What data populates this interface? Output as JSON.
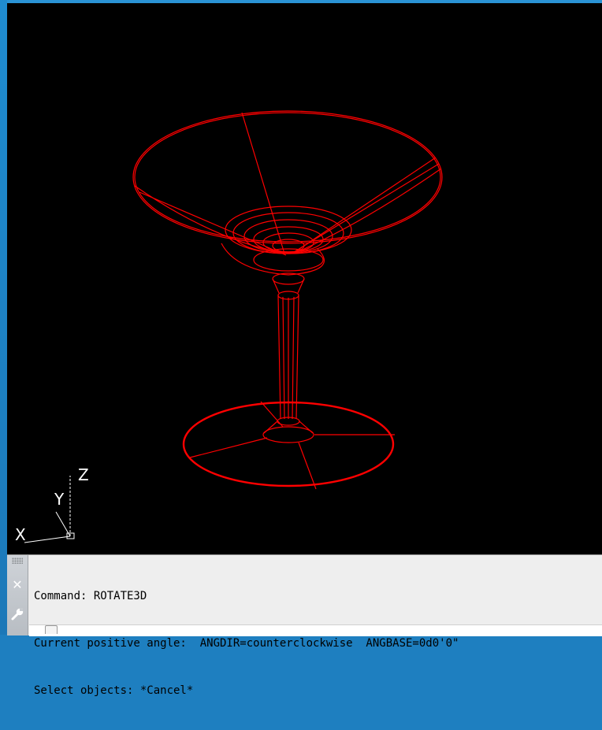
{
  "command_line": {
    "history": [
      "Command: ROTATE3D",
      "Current positive angle:  ANGDIR=counterclockwise  ANGBASE=0d0'0\"",
      "Select objects: *Cancel*"
    ],
    "input_value": ""
  },
  "ucs_icon": {
    "x_label": "X",
    "y_label": "Y",
    "z_label": "Z"
  },
  "colors": {
    "viewport_background": "#000000",
    "model_wireframe": "#ff0000",
    "ucs_icon": "#ffffff",
    "frame_accent": "#1e7fc0",
    "command_panel": "#eeeeee"
  },
  "icons": {
    "close": "close-icon",
    "customize": "wrench-icon",
    "grip": "grip-icon",
    "prompt": "prompt-icon"
  },
  "model": {
    "object": "martini glass wireframe"
  }
}
